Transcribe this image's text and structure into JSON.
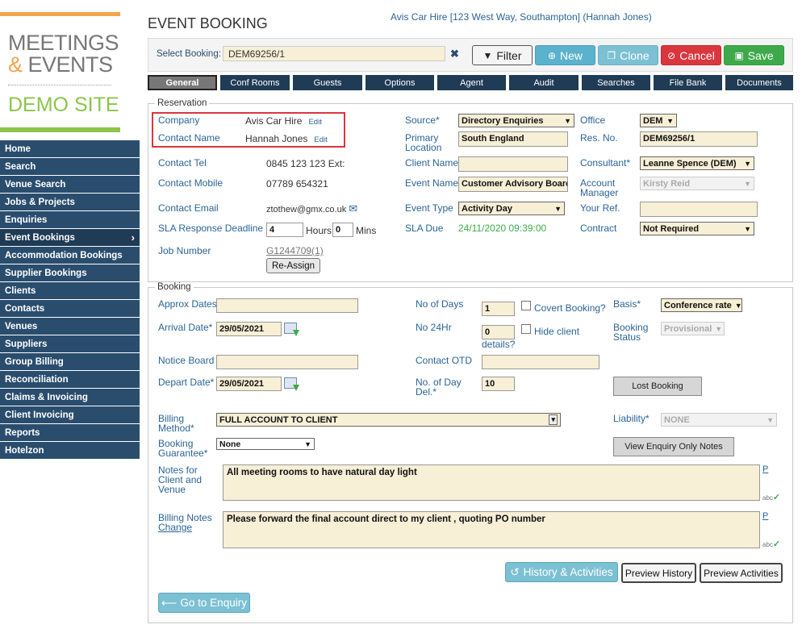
{
  "brand": {
    "line1": "MEETINGS",
    "line2_amp": "&",
    "line2_rest": " EVENTS",
    "demo": "DEMO SITE",
    "accent_orange": "#f2a54a",
    "accent_green": "#8cc54a"
  },
  "nav": {
    "items": [
      {
        "label": "Home"
      },
      {
        "label": "Search"
      },
      {
        "label": "Venue Search"
      },
      {
        "label": "Jobs & Projects"
      },
      {
        "label": "Enquiries"
      },
      {
        "label": "Event Bookings",
        "active": true
      },
      {
        "label": "Accommodation Bookings"
      },
      {
        "label": "Supplier Bookings"
      },
      {
        "label": "Clients"
      },
      {
        "label": "Contacts"
      },
      {
        "label": "Venues"
      },
      {
        "label": "Suppliers"
      },
      {
        "label": "Group Billing"
      },
      {
        "label": "Reconciliation"
      },
      {
        "label": "Claims & Invoicing"
      },
      {
        "label": "Client Invoicing"
      },
      {
        "label": "Reports"
      },
      {
        "label": "Hotelzon"
      }
    ],
    "chevron": "›"
  },
  "header": {
    "title": "EVENT BOOKING",
    "context": "Avis Car Hire [123 West Way, Southampton] (Hannah Jones)"
  },
  "select_bar": {
    "label": "Select Booking:",
    "value": "DEM69256/1",
    "clear": "✖",
    "filter": "Filter",
    "new": "New",
    "clone": "Clone",
    "cancel": "Cancel",
    "save": "Save"
  },
  "tabs": [
    {
      "label": "General",
      "active": true
    },
    {
      "label": "Conf Rooms"
    },
    {
      "label": "Guests"
    },
    {
      "label": "Options"
    },
    {
      "label": "Agent"
    },
    {
      "label": "Audit"
    },
    {
      "label": "Searches"
    },
    {
      "label": "File Bank"
    },
    {
      "label": "Documents"
    }
  ],
  "reservation": {
    "legend": "Reservation",
    "company_label": "Company",
    "company_value": "Avis Car Hire",
    "company_edit": "Edit",
    "contact_name_label": "Contact Name",
    "contact_name_value": "Hannah Jones",
    "contact_name_edit": "Edit",
    "contact_tel_label": "Contact Tel",
    "contact_tel_value": "0845 123 123 Ext:",
    "contact_mobile_label": "Contact Mobile",
    "contact_mobile_value": "07789 654321",
    "contact_email_label": "Contact Email",
    "contact_email_value": "ztothew@gmx.co.uk",
    "sla_label": "SLA Response Deadline",
    "sla_hours_value": "4",
    "sla_hours_label": "Hours",
    "sla_mins_value": "0",
    "sla_mins_label": "Mins",
    "job_number_label": "Job Number",
    "job_number_value": "G1244709(1)",
    "reassign": "Re-Assign",
    "source_label": "Source*",
    "source_value": "Directory Enquiries",
    "primary_location_label1": "Primary",
    "primary_location_label2": "Location",
    "primary_location_value": "South England",
    "client_name_label": "Client Name",
    "client_name_value": "",
    "event_name_label": "Event Name",
    "event_name_value": "Customer Advisory Board",
    "event_type_label": "Event Type",
    "event_type_value": "Activity Day",
    "sla_due_label": "SLA Due",
    "sla_due_value": "24/11/2020 09:39:00",
    "office_label": "Office",
    "office_value": "DEM",
    "res_no_label": "Res. No.",
    "res_no_value": "DEM69256/1",
    "consultant_label": "Consultant*",
    "consultant_value": "Leanne Spence (DEM)",
    "account_manager_label1": "Account",
    "account_manager_label2": "Manager",
    "account_manager_value": "Kirsty Reid",
    "your_ref_label": "Your Ref.",
    "your_ref_value": "",
    "contract_label": "Contract",
    "contract_value": "Not Required"
  },
  "booking": {
    "legend": "Booking",
    "approx_dates_label": "Approx Dates",
    "approx_dates_value": "",
    "arrival_label": "Arrival Date*",
    "arrival_value": "29/05/2021",
    "notice_board_label": "Notice Board",
    "notice_board_value": "",
    "depart_label": "Depart Date*",
    "depart_value": "29/05/2021",
    "no_days_label": "No of Days",
    "no_days_value": "1",
    "covert_label": "Covert Booking?",
    "no24_label": "No 24Hr",
    "no24_value": "0",
    "hide_client_label": "Hide client",
    "details_label": "details?",
    "contact_otd_label": "Contact OTD",
    "contact_otd_value": "",
    "day_del_label1": "No. of Day",
    "day_del_label2": "Del.*",
    "day_del_value": "10",
    "basis_label": "Basis*",
    "basis_value": "Conference rate",
    "booking_status_label1": "Booking",
    "booking_status_label2": "Status",
    "booking_status_value": "Provisional",
    "lost_booking": "Lost Booking",
    "billing_method_label1": "Billing",
    "billing_method_label2": "Method*",
    "billing_method_value": "FULL ACCOUNT TO CLIENT",
    "liability_label": "Liability*",
    "liability_value": "NONE",
    "guarantee_label1": "Booking",
    "guarantee_label2": "Guarantee*",
    "guarantee_value": "None",
    "view_enquiry_notes": "View Enquiry Only Notes",
    "notes_label1": "Notes for",
    "notes_label2": "Client and",
    "notes_label3": "Venue",
    "notes_value": "All meeting rooms to have natural day light",
    "billing_notes_label": "Billing Notes",
    "billing_notes_change": "Change",
    "billing_notes_value": "Please forward the final account direct to my client , quoting PO number",
    "p_link": "P",
    "abc": "abc"
  },
  "actions": {
    "history_activities": "History & Activities",
    "preview_history": "Preview History",
    "preview_activities": "Preview Activities",
    "go_to_enquiry": "Go to Enquiry"
  }
}
